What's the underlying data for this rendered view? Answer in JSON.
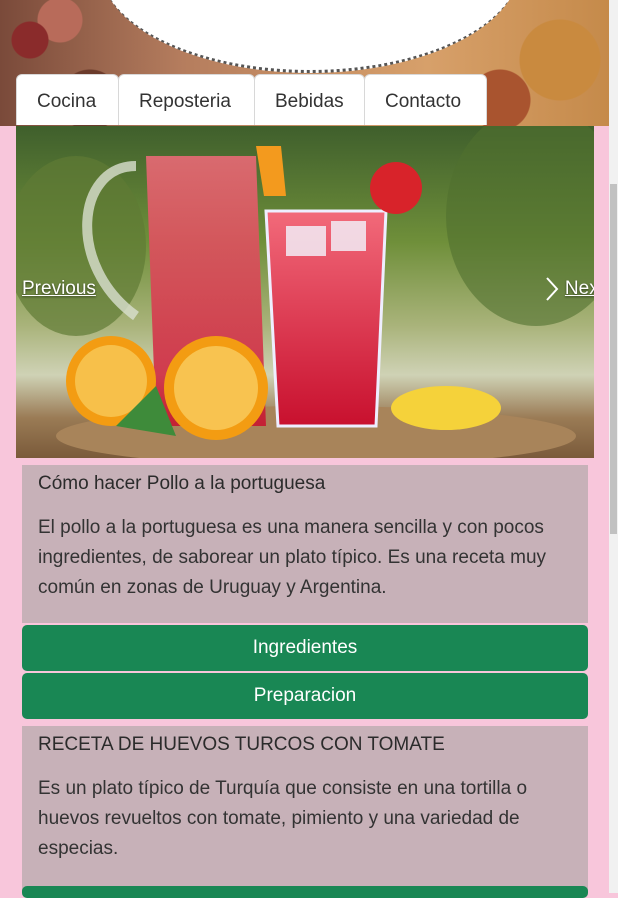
{
  "nav": {
    "tabs": [
      {
        "label": "Cocina"
      },
      {
        "label": "Reposteria"
      },
      {
        "label": "Bebidas"
      },
      {
        "label": "Contacto"
      }
    ]
  },
  "carousel": {
    "prev_label": "Previous",
    "next_label": "Next"
  },
  "recipes": [
    {
      "title": "Cómo hacer Pollo a la portuguesa",
      "text": "El pollo a la portuguesa es una manera sencilla y con pocos ingredientes, de saborear un plato típico. Es una receta muy común en zonas de Uruguay y Argentina.",
      "ingredients_label": "Ingredientes",
      "preparation_label": "Preparacion"
    },
    {
      "title": "RECETA DE HUEVOS TURCOS CON TOMATE",
      "text": "Es un plato típico de Turquía que consiste en una tortilla o huevos revueltos con tomate, pimiento y una variedad de especias."
    }
  ],
  "colors": {
    "page_background": "#f8c6db",
    "card_background": "#c7b1b8",
    "button_green": "#198754"
  }
}
